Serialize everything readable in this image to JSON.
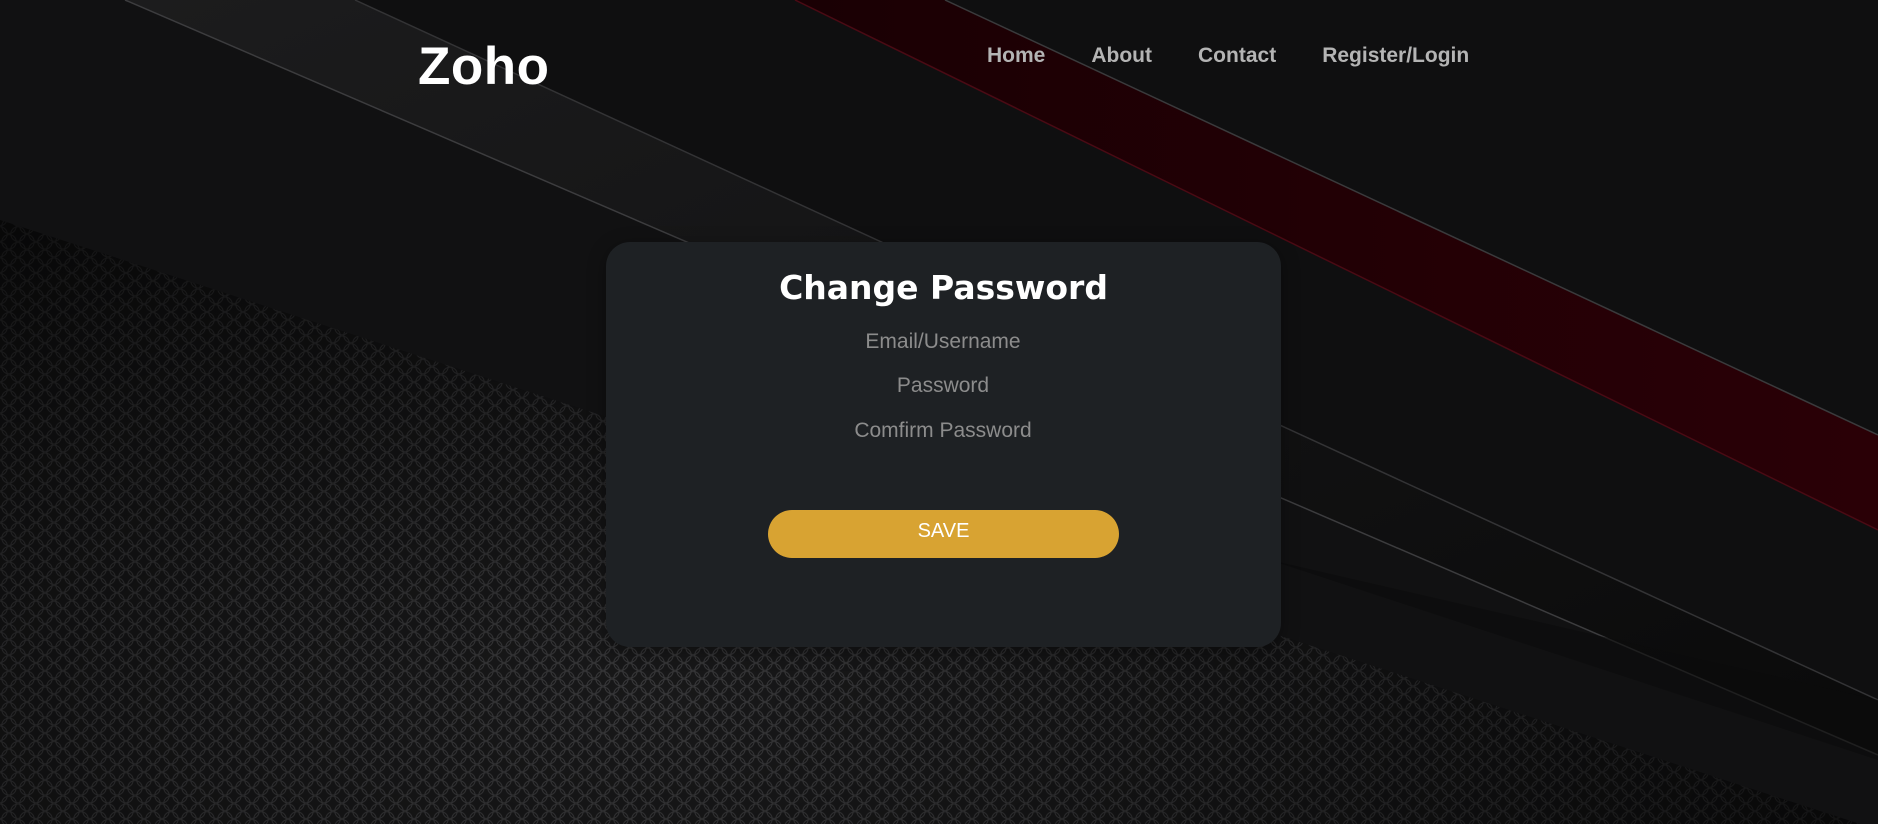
{
  "header": {
    "logo": "Zoho",
    "nav": [
      {
        "label": "Home"
      },
      {
        "label": "About"
      },
      {
        "label": "Contact"
      },
      {
        "label": "Register/Login"
      }
    ]
  },
  "form": {
    "title": "Change Password",
    "fields": [
      {
        "placeholder": "Email/Username",
        "value": ""
      },
      {
        "placeholder": "Password",
        "value": ""
      },
      {
        "placeholder": "Comfirm Password",
        "value": ""
      }
    ],
    "save_label": "SAVE"
  },
  "colors": {
    "background": "#0c0c0d",
    "card": "#1e2124",
    "button": "#d8a332",
    "accent_stripe": "#3a0008"
  }
}
